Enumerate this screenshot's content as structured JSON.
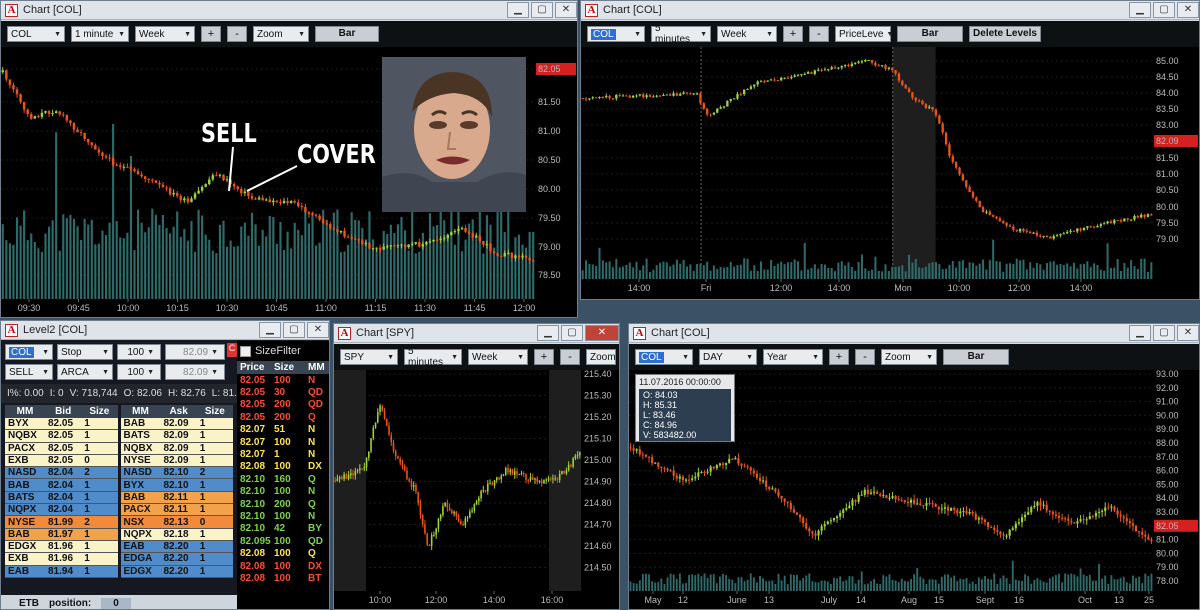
{
  "win1": {
    "title": "Chart [COL]",
    "symbol": "COL",
    "interval": "1 minute",
    "range": "Week",
    "zoom": "Zoom",
    "style": "Bar",
    "yticks": [
      "82.05",
      "81.50",
      "81.00",
      "80.50",
      "80.00",
      "79.50",
      "79.00",
      "78.50"
    ],
    "xticks": [
      "09:30",
      "09:45",
      "10:00",
      "10:15",
      "10:30",
      "10:45",
      "11:00",
      "11:15",
      "11:30",
      "11:45",
      "12:00"
    ],
    "annot_sell": "SELL",
    "annot_cover": "COVER"
  },
  "win2": {
    "title": "Chart [COL]",
    "symbol": "COL",
    "interval": "5 minutes",
    "range": "Week",
    "indicator": "PriceLeve",
    "style": "Bar",
    "delete_levels": "Delete Levels",
    "yticks": [
      "85.00",
      "84.50",
      "84.00",
      "83.50",
      "83.00",
      "82.09",
      "81.50",
      "81.00",
      "80.50",
      "80.00",
      "79.50",
      "79.00"
    ],
    "xticks": [
      "14:00",
      "Fri",
      "12:00",
      "14:00",
      "Mon",
      "10:00",
      "12:00",
      "14:00"
    ]
  },
  "level2": {
    "title": "Level2 [COL]",
    "symbol": "COL",
    "order_type": "Stop",
    "qty1": "100",
    "price1": "82.09",
    "side": "SELL",
    "route": "ARCA",
    "qty2": "100",
    "price2": "82.09",
    "summary": {
      "pct": "I%: 0.00",
      "i": "I: 0",
      "v": "V: 718,744",
      "o": "O: 82.06",
      "h": "H: 82.76",
      "l": "L: 81.4"
    },
    "bid_headers": [
      "MM",
      "Bid",
      "Size"
    ],
    "ask_headers": [
      "MM",
      "Ask",
      "Size"
    ],
    "bids": [
      [
        "BYX",
        "82.05",
        "1"
      ],
      [
        "NQBX",
        "82.05",
        "1"
      ],
      [
        "PACX",
        "82.05",
        "1"
      ],
      [
        "EXB",
        "82.05",
        "0"
      ],
      [
        "NASD",
        "82.04",
        "2"
      ],
      [
        "BAB",
        "82.04",
        "1"
      ],
      [
        "BATS",
        "82.04",
        "1"
      ],
      [
        "NQPX",
        "82.04",
        "1"
      ],
      [
        "NYSE",
        "81.99",
        "2"
      ],
      [
        "BAB",
        "81.97",
        "1"
      ],
      [
        "EDGX",
        "81.96",
        "1"
      ],
      [
        "EXB",
        "81.96",
        "1"
      ],
      [
        "EAB",
        "81.94",
        "1"
      ]
    ],
    "asks": [
      [
        "BAB",
        "82.09",
        "1"
      ],
      [
        "BATS",
        "82.09",
        "1"
      ],
      [
        "NQBX",
        "82.09",
        "1"
      ],
      [
        "NYSE",
        "82.09",
        "1"
      ],
      [
        "NASD",
        "82.10",
        "2"
      ],
      [
        "BYX",
        "82.10",
        "1"
      ],
      [
        "BAB",
        "82.11",
        "1"
      ],
      [
        "PACX",
        "82.11",
        "1"
      ],
      [
        "NSX",
        "82.13",
        "0"
      ],
      [
        "NQPX",
        "82.18",
        "1"
      ],
      [
        "EAB",
        "82.20",
        "1"
      ],
      [
        "EDGA",
        "82.20",
        "1"
      ],
      [
        "EDGX",
        "82.20",
        "1"
      ]
    ],
    "etb": "ETB",
    "position": "position:",
    "position_val": "0"
  },
  "sizefilter": {
    "label": "SizeFilter",
    "headers": [
      "Price",
      "Size",
      "MM"
    ],
    "rows": [
      [
        "82.05",
        "100",
        "N"
      ],
      [
        "82.05",
        "30",
        "QD"
      ],
      [
        "82.05",
        "200",
        "QD"
      ],
      [
        "82.05",
        "200",
        "Q"
      ],
      [
        "82.07",
        "51",
        "N"
      ],
      [
        "82.07",
        "100",
        "N"
      ],
      [
        "82.07",
        "1",
        "N"
      ],
      [
        "82.08",
        "100",
        "DX"
      ],
      [
        "82.10",
        "160",
        "Q"
      ],
      [
        "82.10",
        "100",
        "N"
      ],
      [
        "82.10",
        "200",
        "Q"
      ],
      [
        "82.10",
        "100",
        "N"
      ],
      [
        "82.10",
        "42",
        "BY"
      ],
      [
        "82.095",
        "100",
        "QD"
      ],
      [
        "82.08",
        "100",
        "Q"
      ],
      [
        "82.08",
        "100",
        "DX"
      ],
      [
        "82.08",
        "100",
        "BT"
      ]
    ]
  },
  "win3": {
    "title": "Chart [SPY]",
    "symbol": "SPY",
    "interval": "5 minutes",
    "range": "Week",
    "zoom": "Zoom",
    "yticks": [
      "215.40",
      "215.20",
      "215.00",
      "214.80",
      "214.60",
      "214.50"
    ],
    "yticks_all": [
      "215.40",
      "215.30",
      "215.20",
      "215.10",
      "215.00",
      "214.90",
      "214.80",
      "214.70",
      "214.60",
      "214.50"
    ],
    "xticks": [
      "10:00",
      "12:00",
      "14:00",
      "16:00"
    ]
  },
  "win4": {
    "title": "Chart [COL]",
    "symbol": "COL",
    "interval": "DAY",
    "range": "Year",
    "zoom": "Zoom",
    "style": "Bar",
    "tooltip": {
      "date": "11.07.2016 00:00:00",
      "o": "O: 84.03",
      "h": "H: 85.31",
      "l": "L: 83.46",
      "c": "C: 84.96",
      "v": "V: 583482.00"
    },
    "yticks": [
      "93.00",
      "92.00",
      "91.00",
      "90.00",
      "89.00",
      "88.00",
      "87.00",
      "86.00",
      "85.00",
      "84.00",
      "83.00",
      "82.05",
      "81.00",
      "80.00",
      "79.00",
      "78.00"
    ],
    "xticks": [
      "May",
      "12",
      "June",
      "13",
      "July",
      "14",
      "Aug",
      "15",
      "Sept",
      "16",
      "Oct",
      "13",
      "25"
    ]
  },
  "colors": {
    "up": "#9fd13b",
    "down": "#e8541a",
    "bg": "#000000",
    "vol": "#2f6b6b",
    "bidblue": "#4f8cc9",
    "askorange": "#f2a24a",
    "lightrow": "#fbf3c8",
    "price_tag": "#d42020"
  }
}
